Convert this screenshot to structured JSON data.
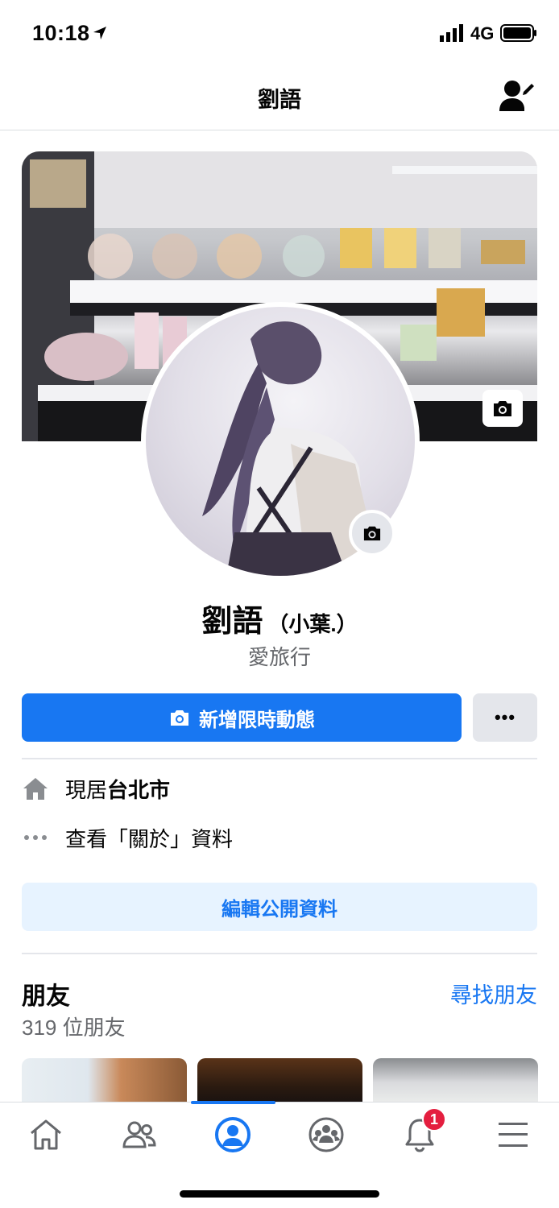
{
  "status_bar": {
    "time": "10:18",
    "network": "4G",
    "location_icon": "location-arrow-icon",
    "signal_icon": "cellular-signal-icon",
    "battery_icon": "battery-icon"
  },
  "header": {
    "title": "劉語",
    "action_icon": "edit-profile-user-icon"
  },
  "profile": {
    "name": "劉語",
    "alternate_name": "（小葉.）",
    "bio": "愛旅行",
    "cover_camera_icon": "camera-icon",
    "avatar_camera_icon": "camera-icon"
  },
  "actions": {
    "add_story_label": "新增限時動態",
    "add_story_icon": "camera-icon",
    "more_label": "•••"
  },
  "intro": {
    "lives_in_prefix": "現居",
    "lives_in_city": "台北市",
    "lives_in_icon": "home-icon",
    "about_label": "查看「關於」資料",
    "about_icon": "more-dots-icon"
  },
  "edit_profile_label": "編輯公開資料",
  "friends": {
    "title": "朋友",
    "count_label": "319 位朋友",
    "find_friends_label": "尋找朋友"
  },
  "bottom_nav": {
    "items": [
      {
        "name": "home",
        "icon": "home-icon"
      },
      {
        "name": "friends",
        "icon": "friends-icon"
      },
      {
        "name": "profile",
        "icon": "profile-icon",
        "active": true
      },
      {
        "name": "groups",
        "icon": "groups-icon"
      },
      {
        "name": "notifications",
        "icon": "bell-icon",
        "badge": "1"
      },
      {
        "name": "menu",
        "icon": "menu-icon"
      }
    ]
  },
  "colors": {
    "accent": "#1877f2",
    "badge": "#e41e3f",
    "secondary_button": "#e4e6eb",
    "light_accent": "#e7f3ff",
    "muted_text": "#65676b"
  }
}
